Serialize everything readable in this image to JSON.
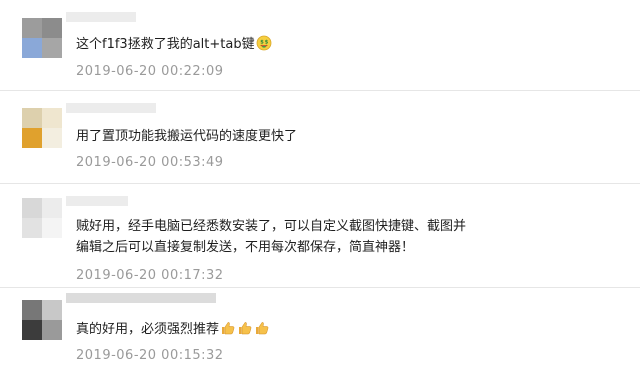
{
  "comments": [
    {
      "text": "这个f1f3拯救了我的alt+tab键",
      "emoji": "money-face-icon",
      "timestamp": "2019-06-20 00:22:09",
      "avatar_colors": [
        "#9c9c9c",
        "#8c8c8c",
        "#8aa8d8",
        "#a6a6a6"
      ]
    },
    {
      "text": "用了置顶功能我搬运代码的速度更快了",
      "timestamp": "2019-06-20 00:53:49",
      "avatar_colors": [
        "#ddd0ad",
        "#efe6cf",
        "#e0a12d",
        "#f3eee0"
      ]
    },
    {
      "lines": [
        "贼好用，经手电脑已经悉数安装了，可以自定义截图快捷键、截图并",
        "编辑之后可以直接复制发送，不用每次都保存，简直神器！"
      ],
      "timestamp": "2019-06-20 00:17:32",
      "avatar_colors": [
        "#d8d8d8",
        "#ececec",
        "#e2e2e2",
        "#f4f4f4"
      ]
    },
    {
      "text": "真的好用，必须强烈推荐",
      "emoji": "thumbs-up-icon",
      "emoji_count": 3,
      "timestamp": "2019-06-20 00:15:32",
      "avatar_colors": [
        "#777777",
        "#c8c8c8",
        "#3c3c3c",
        "#9a9a9a"
      ]
    }
  ],
  "colors": {
    "timestamp": "#9a9a9a",
    "divider": "#e6e6e6",
    "text": "#1e1e1e"
  }
}
